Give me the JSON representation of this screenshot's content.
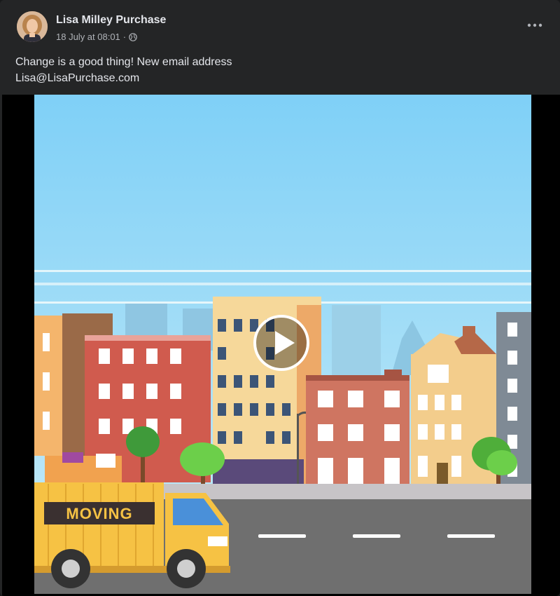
{
  "post": {
    "author": "Lisa Milley Purchase",
    "date": "18 July at 08:01",
    "separator": "·",
    "privacy_icon": "globe-icon",
    "menu_icon": "more-options-icon",
    "text_line1": "Change is a good thing! New email address",
    "text_line2": "Lisa@LisaPurchase.com"
  },
  "video": {
    "truck_label": "MOVING",
    "play_icon": "play-icon"
  },
  "colors": {
    "background": "#242526",
    "text": "#e4e6eb",
    "secondary_text": "#b0b3b8",
    "sky": "#a8dcf2",
    "road": "#6f6f6f",
    "truck": "#f6c244"
  }
}
